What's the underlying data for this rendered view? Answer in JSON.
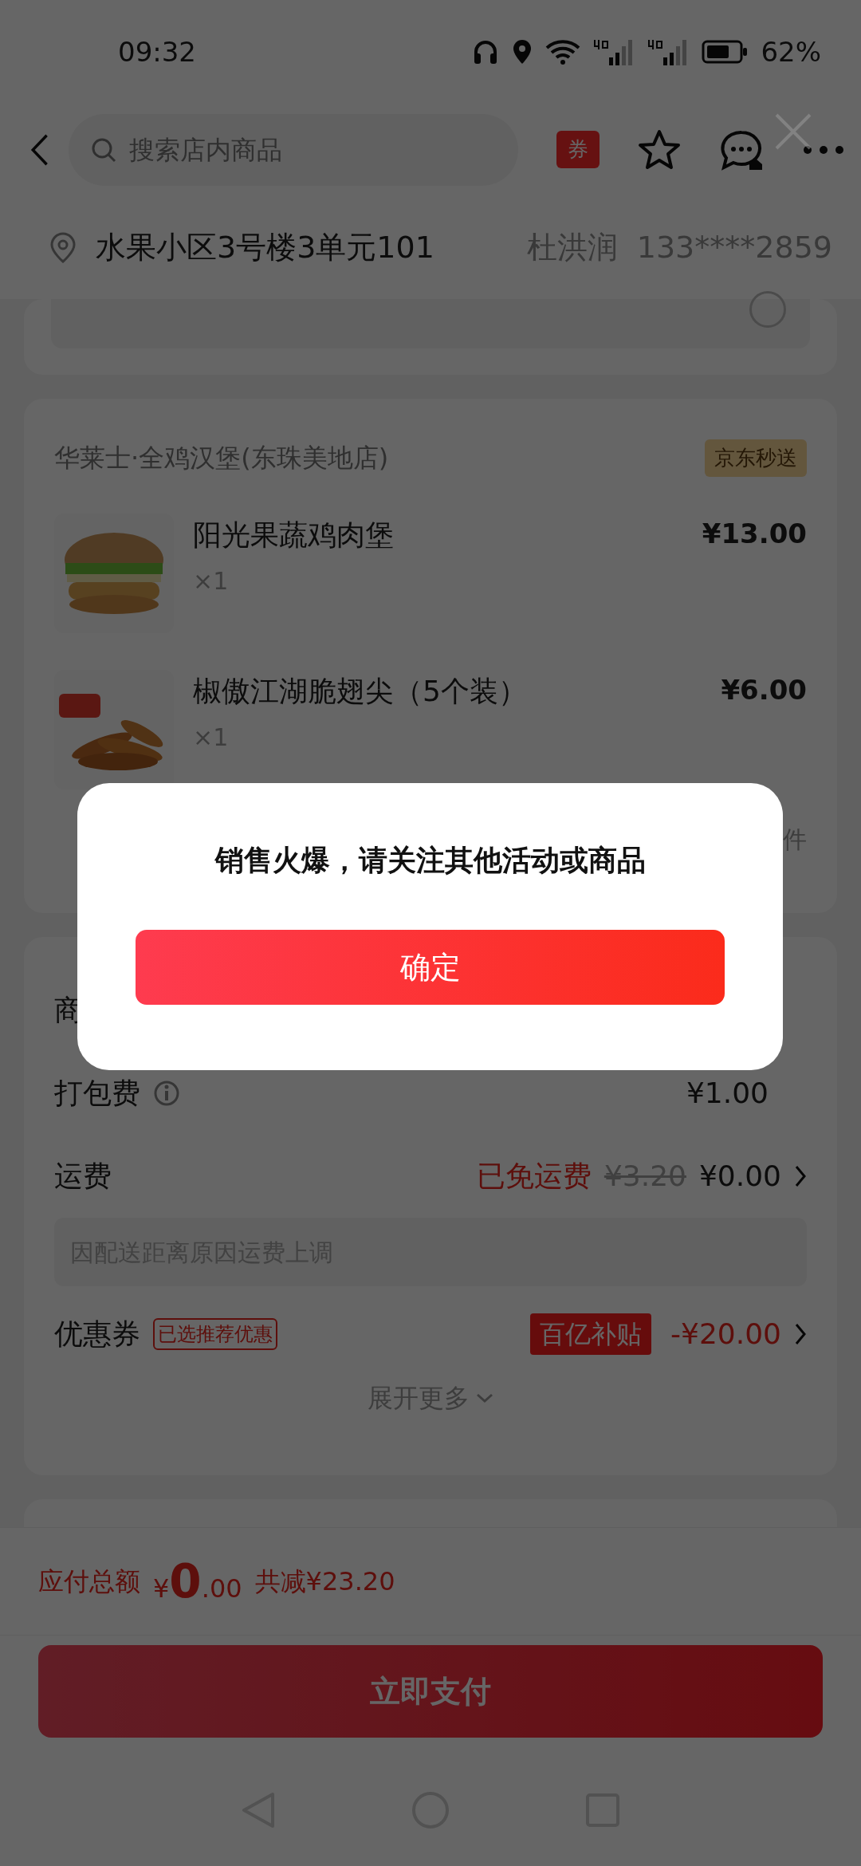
{
  "status_bar": {
    "time": "09:32",
    "battery": "62%"
  },
  "header": {
    "search": {
      "placeholder": "搜索店内商品"
    },
    "coupon_badge": "券"
  },
  "address": {
    "text": "水果小区3号楼3单元101",
    "name": "杜洪润",
    "phone": "133****2859"
  },
  "schedule": {
    "selected": false
  },
  "store": {
    "name": "华莱士·全鸡汉堡(东珠美地店)",
    "tag": "京东秒送",
    "items": [
      {
        "name": "阳光果蔬鸡肉堡",
        "quantity": "×1",
        "price": "¥13.00",
        "kind": "burger"
      },
      {
        "name": "椒傲江湖脆翅尖（5个装）",
        "quantity": "×1",
        "price": "¥6.00",
        "kind": "wings"
      }
    ],
    "count_fragment": "件"
  },
  "fees": {
    "goods_label_fragment": "商",
    "packing": {
      "label": "打包费",
      "amount": "¥1.00"
    },
    "delivery": {
      "label": "运费",
      "status": "已免运费",
      "original": "¥3.20",
      "amount": "¥0.00"
    },
    "note": "因配送距离原因运费上调",
    "coupon": {
      "label": "优惠券",
      "tag": "已选推荐优惠",
      "badge": "百亿补贴",
      "amount": "-¥20.00"
    },
    "expand": "展开更多"
  },
  "footer": {
    "total_label": "应付总额",
    "currency": "¥",
    "total_int": "0",
    "total_dec": ".00",
    "saved": "共减¥23.20",
    "pay_button": "立即支付"
  },
  "dialog": {
    "message": "销售火爆，请关注其他活动或商品",
    "confirm": "确定"
  }
}
